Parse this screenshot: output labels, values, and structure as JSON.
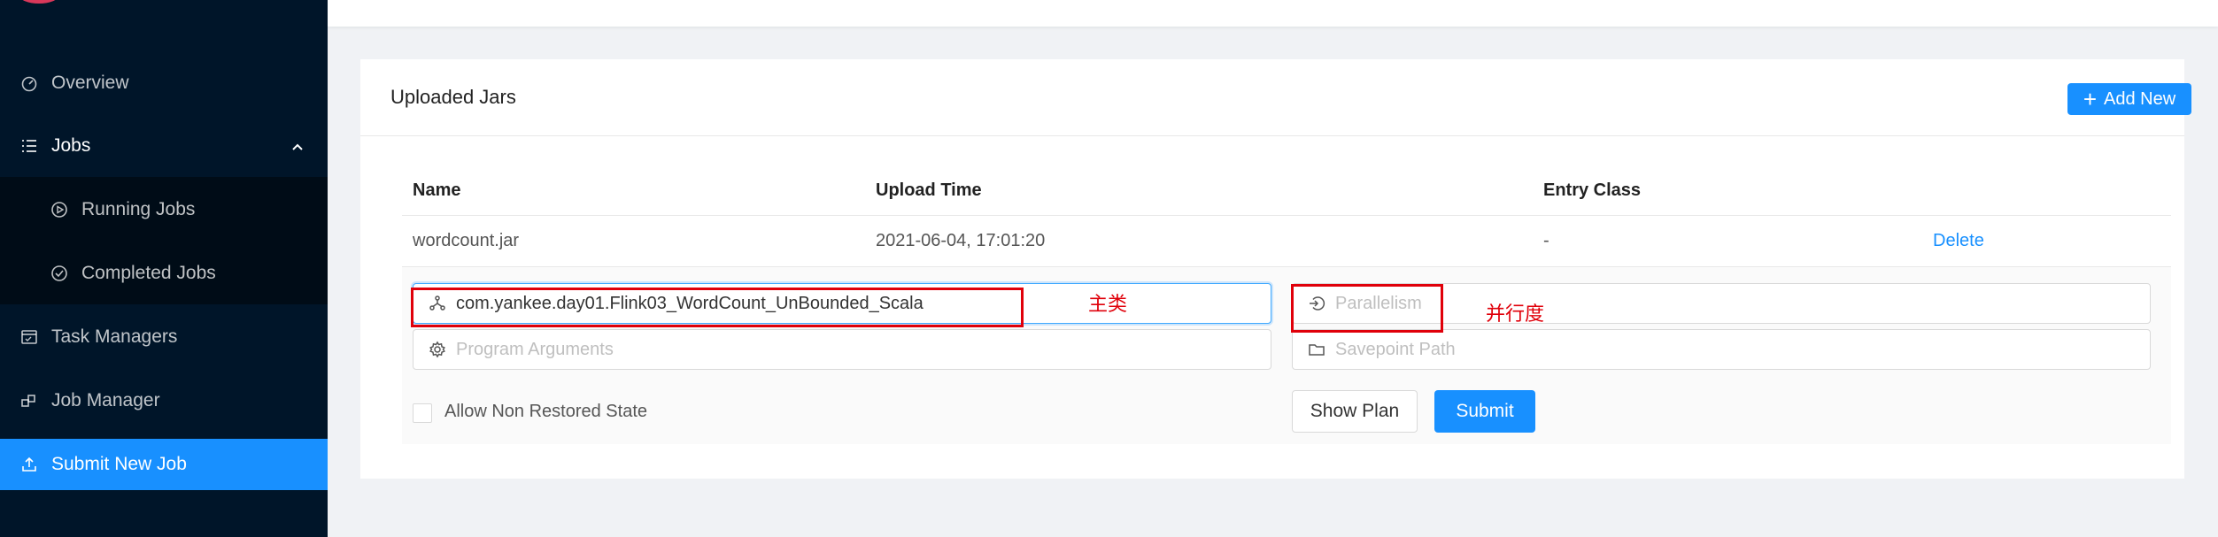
{
  "colors": {
    "sidebar_bg": "#001529",
    "accent": "#1890ff",
    "annotation": "#e0000a"
  },
  "sidebar": {
    "items": [
      {
        "label": "Overview",
        "icon": "dashboard-icon"
      },
      {
        "label": "Jobs",
        "icon": "list-icon"
      },
      {
        "label": "Running Jobs",
        "icon": "play-circle-icon"
      },
      {
        "label": "Completed Jobs",
        "icon": "check-circle-icon"
      },
      {
        "label": "Task Managers",
        "icon": "schedule-icon"
      },
      {
        "label": "Job Manager",
        "icon": "build-icon"
      },
      {
        "label": "Submit New Job",
        "icon": "upload-icon"
      }
    ]
  },
  "card": {
    "title": "Uploaded Jars",
    "add_label": "Add New"
  },
  "table": {
    "columns": [
      "Name",
      "Upload Time",
      "Entry Class"
    ],
    "rows": [
      {
        "name": "wordcount.jar",
        "upload_time": "2021-06-04, 17:01:20",
        "entry_class": "-",
        "action": "Delete"
      }
    ]
  },
  "form": {
    "entry_class_value": "com.yankee.day01.Flink03_WordCount_UnBounded_Scala",
    "parallelism_placeholder": "Parallelism",
    "program_args_placeholder": "Program Arguments",
    "savepoint_placeholder": "Savepoint Path",
    "allow_non_restored_label": "Allow Non Restored State",
    "show_plan_label": "Show Plan",
    "submit_label": "Submit"
  },
  "annotations": {
    "main_class": "主类",
    "parallelism": "并行度"
  }
}
